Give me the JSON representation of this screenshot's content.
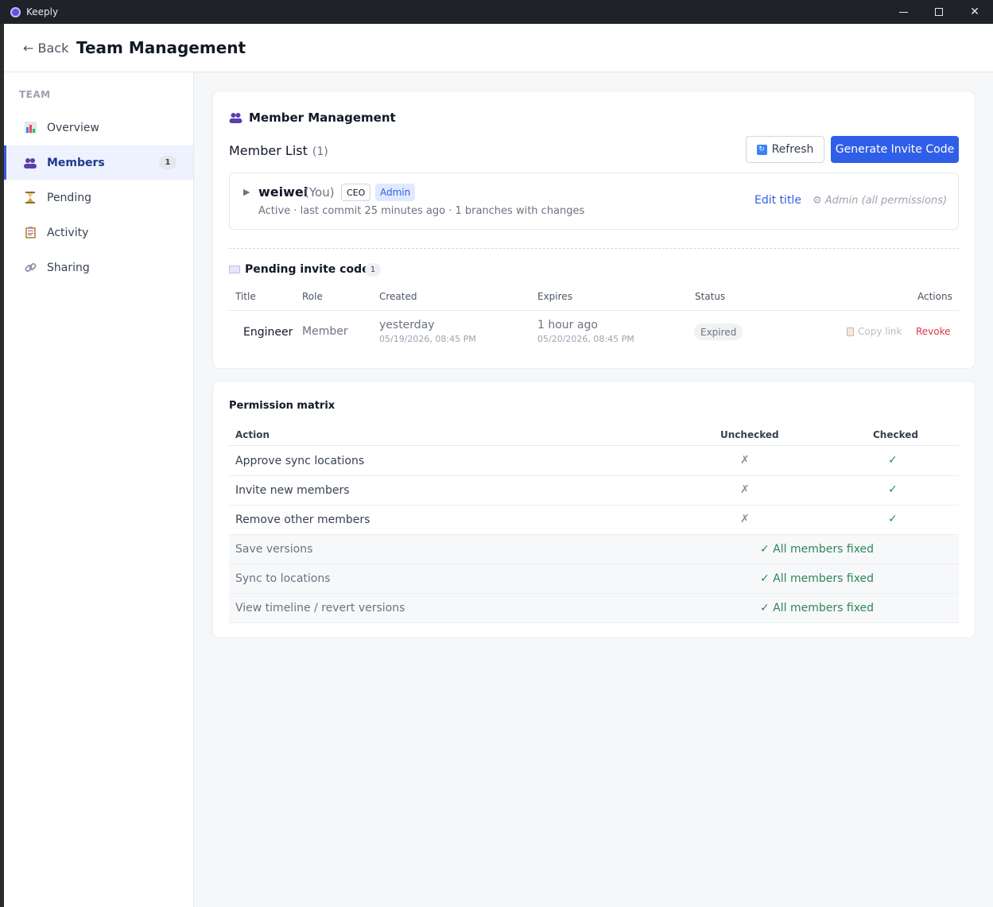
{
  "window": {
    "app_name": "Keeply"
  },
  "header": {
    "back_label": "← Back",
    "title": "Team Management"
  },
  "sidebar": {
    "section": "TEAM",
    "items": [
      {
        "label": "Overview",
        "icon": "chart-icon"
      },
      {
        "label": "Members",
        "icon": "people-icon",
        "badge": "1",
        "active": true
      },
      {
        "label": "Pending",
        "icon": "hourglass-icon"
      },
      {
        "label": "Activity",
        "icon": "clipboard-icon"
      },
      {
        "label": "Sharing",
        "icon": "link-icon"
      }
    ]
  },
  "member_management": {
    "title": "Member Management",
    "list_label": "Member List",
    "list_count": "(1)",
    "refresh_label": "Refresh",
    "invite_label": "Generate Invite Code",
    "member": {
      "name": "weiwei",
      "you": "(You)",
      "title_tag": "CEO",
      "role_tag": "Admin",
      "meta": "Active · last commit 25 minutes ago · 1 branches with changes",
      "edit_title": "Edit title",
      "permissions": "⚙ Admin (all permissions)"
    }
  },
  "pending_invites": {
    "title": "Pending invite codes",
    "count": "1",
    "headers": {
      "title": "Title",
      "role": "Role",
      "created": "Created",
      "expires": "Expires",
      "status": "Status",
      "actions": "Actions"
    },
    "rows": [
      {
        "title": "Engineer",
        "role": "Member",
        "created": "yesterday",
        "created_exact": "05/19/2026, 08:45 PM",
        "expires": "1 hour ago",
        "expires_exact": "05/20/2026, 08:45 PM",
        "status": "Expired",
        "copy_link": "Copy link",
        "revoke": "Revoke"
      }
    ]
  },
  "permission_matrix": {
    "title": "Permission matrix",
    "headers": {
      "action": "Action",
      "unchecked": "Unchecked",
      "checked": "Checked"
    },
    "rows": [
      {
        "action": "Approve sync locations",
        "unchecked": "✗",
        "checked": "✓"
      },
      {
        "action": "Invite new members",
        "unchecked": "✗",
        "checked": "✓"
      },
      {
        "action": "Remove other members",
        "unchecked": "✗",
        "checked": "✓"
      },
      {
        "action": "Save versions",
        "fixed": "✓ All members fixed"
      },
      {
        "action": "Sync to locations",
        "fixed": "✓ All members fixed"
      },
      {
        "action": "View timeline / revert versions",
        "fixed": "✓ All members fixed"
      }
    ]
  },
  "colors": {
    "accent": "#2f5fe8",
    "danger": "#dc3545",
    "success": "#2f855a"
  }
}
